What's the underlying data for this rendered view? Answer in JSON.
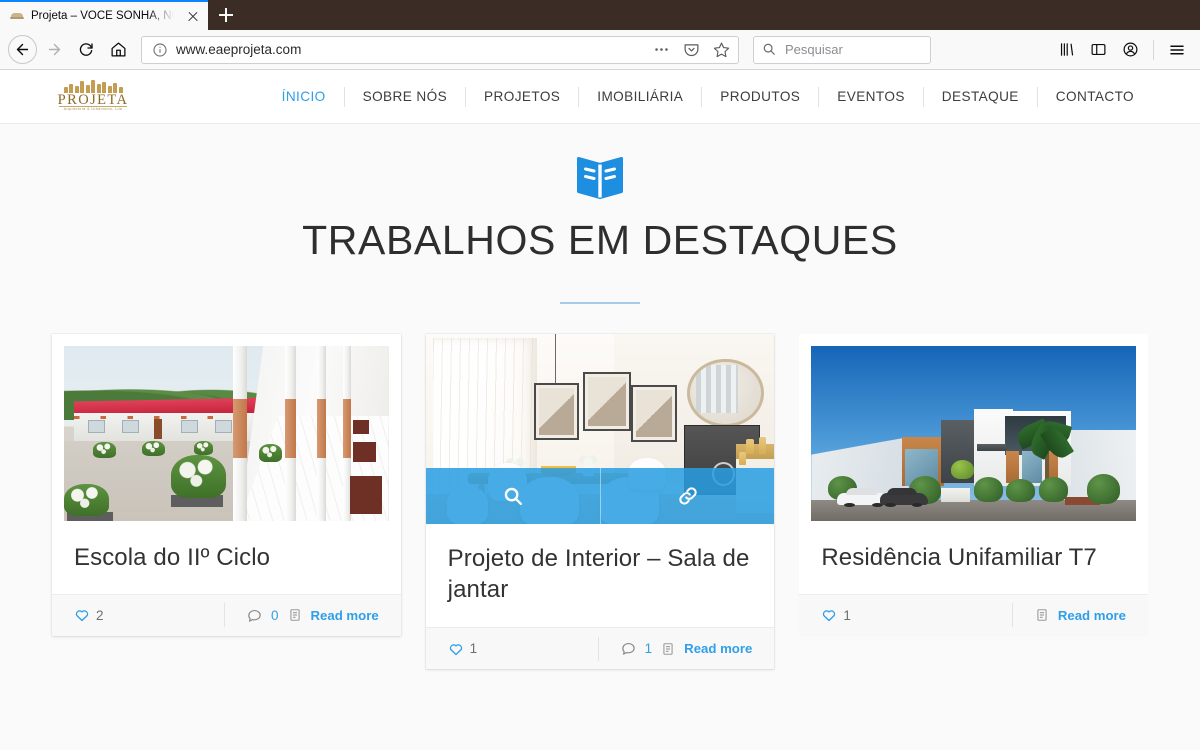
{
  "browser": {
    "tab": {
      "title": "Projeta – VOCÊ SONHA, NÓS PR",
      "favicon_name": "site-favicon",
      "close_label": "×"
    },
    "new_tab_label": "+",
    "toolbar": {
      "back_label": "Back",
      "forward_label": "Forward",
      "reload_label": "Reload",
      "home_label": "Home"
    },
    "url": {
      "value": "www.eaeprojeta.com",
      "info_icon": "page-info-icon",
      "page_actions_icon": "ellipsis-icon",
      "pocket_icon": "pocket-icon",
      "bookmark_icon": "star-icon"
    },
    "search": {
      "placeholder": "Pesquisar",
      "icon": "search-icon"
    },
    "right_icons": {
      "library": "library-icon",
      "sidebar": "sidebar-icon",
      "account": "account-icon",
      "menu": "hamburger-menu-icon"
    }
  },
  "site": {
    "logo": {
      "wordmark": "PROJETA",
      "tagline": "Arquitetura & Urbanismo, Lda"
    },
    "nav": [
      {
        "label": "ÍNICIO",
        "active": true
      },
      {
        "label": "SOBRE NÓS",
        "active": false
      },
      {
        "label": "PROJETOS",
        "active": false
      },
      {
        "label": "IMOBILIÁRIA",
        "active": false
      },
      {
        "label": "PRODUTOS",
        "active": false
      },
      {
        "label": "EVENTOS",
        "active": false
      },
      {
        "label": "DESTAQUE",
        "active": false
      },
      {
        "label": "CONTACTO",
        "active": false
      }
    ]
  },
  "section": {
    "icon": "open-book-icon",
    "title": "TRABALHOS EM DESTAQUES",
    "accent_color": "#1e8ee0",
    "rule_color": "#a9c9ea"
  },
  "cards": [
    {
      "title": "Escola do IIº Ciclo",
      "image_alt": "school-courtyard-render",
      "likes": "2",
      "comments": "0",
      "read_more": "Read more",
      "has_comments": true,
      "hovered": false
    },
    {
      "title": "Projeto de Interior – Sala de jantar",
      "image_alt": "dining-room-interior-render",
      "likes": "1",
      "comments": "1",
      "read_more": "Read more",
      "has_comments": true,
      "hovered": true,
      "overlay": {
        "zoom_icon": "magnifier-icon",
        "link_icon": "chain-link-icon"
      }
    },
    {
      "title": "Residência Unifamiliar T7",
      "image_alt": "modern-villa-render",
      "likes": "1",
      "comments": null,
      "read_more": "Read more",
      "has_comments": false,
      "hovered": false
    }
  ]
}
